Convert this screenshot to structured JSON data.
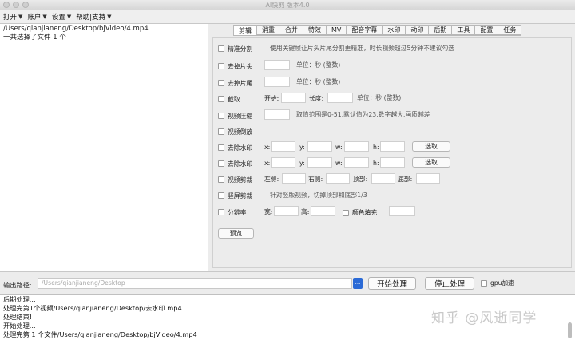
{
  "window": {
    "title": "AI快剪  版本4.0"
  },
  "menubar": [
    {
      "label": "打开"
    },
    {
      "label": "账户"
    },
    {
      "label": "设置"
    },
    {
      "label": "帮助|支持"
    }
  ],
  "left_pane": {
    "lines": [
      "/Users/qianjianeng/Desktop/bjVideo/4.mp4",
      "一共选择了文件 1 个"
    ]
  },
  "tabs": [
    "剪辑",
    "消重",
    "合并",
    "特效",
    "MV",
    "配音字幕",
    "水印",
    "动印",
    "后期",
    "工具",
    "配置",
    "任务"
  ],
  "active_tab": "剪辑",
  "options": {
    "precise_split": {
      "label": "精准分割",
      "hint": "使用关键帧让片头片尾分割更精准，时长视频超过5分钟不建议勾选"
    },
    "remove_head": {
      "label": "去掉片头",
      "unit": "单位：秒 (整数)"
    },
    "remove_tail": {
      "label": "去掉片尾",
      "unit": "单位：秒 (整数)"
    },
    "crop": {
      "label": "截取",
      "start_label": "开始:",
      "length_label": "长度:",
      "unit": "单位：秒 (整数)"
    },
    "compress": {
      "label": "视频压缩",
      "hint": "取值范围是0-51,默认值为23,数字越大,画质越差"
    },
    "reverse": {
      "label": "视频倒放"
    },
    "watermark1": {
      "label": "去除水印",
      "x": "x:",
      "y": "y:",
      "w": "w:",
      "h": "h:",
      "select": "选取"
    },
    "watermark2": {
      "label": "去除水印",
      "x": "x:",
      "y": "y:",
      "w": "w:",
      "h": "h:",
      "select": "选取"
    },
    "video_crop": {
      "label": "视频剪裁",
      "left": "左侧:",
      "right": "右侧:",
      "top": "顶部:",
      "bottom": "底部:"
    },
    "vertical": {
      "label": "竖屏剪裁",
      "hint": "针对竖版视频，切掉顶部和底部1/3"
    },
    "resolution": {
      "label": "分辨率",
      "width": "宽:",
      "height": "高:",
      "fill": "颜色填充"
    },
    "preview": "预览"
  },
  "output": {
    "label": "输出路径:",
    "placeholder": "/Users/qianjianeng/Desktop",
    "browse": "...",
    "start": "开始处理",
    "stop": "停止处理",
    "gpu": "gpu加速"
  },
  "log": [
    "后期处理...",
    "处理完第1个视频/Users/qianjianeng/Desktop/去水印.mp4",
    "处理结束!",
    "开始处理...",
    "处理完第 1 个文件/Users/qianjianeng/Desktop/bjVideo/4.mp4"
  ],
  "watermark_text": "知乎 @风逝同学"
}
